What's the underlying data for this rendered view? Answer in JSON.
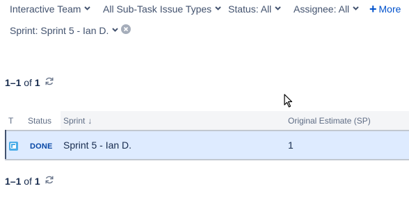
{
  "filters": [
    {
      "label": "Interactive Team"
    },
    {
      "label": "All Sub-Task Issue Types"
    },
    {
      "label": "Status: All"
    },
    {
      "label": "Assignee: All"
    }
  ],
  "more": {
    "plus": "+",
    "label": "More"
  },
  "sprint_filter": {
    "label": "Sprint: Sprint 5 - Ian D."
  },
  "pager_top": {
    "range": "1–1",
    "of": "of",
    "total": "1"
  },
  "pager_bottom": {
    "range": "1–1",
    "of": "of",
    "total": "1"
  },
  "table": {
    "headers": {
      "type": "T",
      "status": "Status",
      "sprint": "Sprint",
      "sort_arrow": "↓",
      "estimate": "Original Estimate (SP)"
    },
    "rows": [
      {
        "status": "DONE",
        "sprint": "Sprint 5 - Ian D.",
        "estimate": "1"
      }
    ]
  },
  "icons": {
    "issue_type": "subtask-icon",
    "refresh": "refresh-icon",
    "clear": "clear-icon",
    "chevron": "chevron-down-icon",
    "cursor": "mouse-pointer-icon"
  },
  "colors": {
    "accent": "#0052cc",
    "row_selected_bg": "#deebff",
    "header_bg": "#f4f5f7",
    "lozenge_text": "#0747a6",
    "subtask_icon": "#4bade8"
  }
}
